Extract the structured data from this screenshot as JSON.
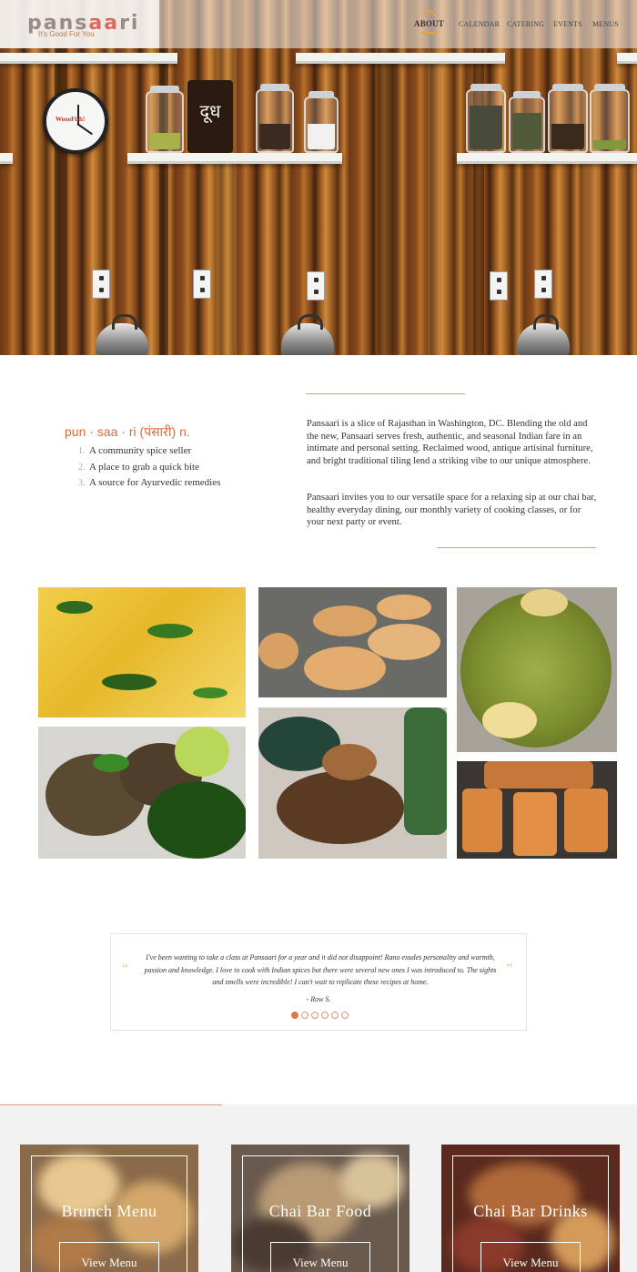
{
  "brand": {
    "name_part1": "pans",
    "name_accent": "aa",
    "name_part2": "ri",
    "tagline": "It's Good For You"
  },
  "nav": {
    "items": [
      {
        "label": "ABOUT",
        "active": true
      },
      {
        "label": "CALENDAR",
        "active": false
      },
      {
        "label": "CATERING",
        "active": false
      },
      {
        "label": "EVENTS",
        "active": false
      },
      {
        "label": "MENUS",
        "active": false
      }
    ]
  },
  "hero": {
    "mug_text": "दूध",
    "clock_text": "WoooFish!"
  },
  "about": {
    "pronunciation": "pun · saa · ri (पंसारी) n.",
    "definitions": [
      {
        "num": "1.",
        "text": "A community spice seller"
      },
      {
        "num": "2.",
        "text": "A place to grab a quick bite"
      },
      {
        "num": "3.",
        "text": "A source for Ayurvedic remedies"
      }
    ],
    "paragraph1": "Pansaari is a slice of Rajasthan in Washington, DC. Blending the old and the new, Pansaari serves fresh, authentic, and seasonal Indian fare in an intimate and personal setting. Reclaimed wood, antique artisinal furniture, and bright traditional tiling lend a striking vibe to our unique atmosphere.",
    "paragraph2": "Pansaari invites you to our versatile space for a relaxing sip at our chai bar, healthy everyday dining, our monthly variety of cooking classes, or for your next party or event."
  },
  "testimonial": {
    "open_quote": "“",
    "close_quote": "”",
    "quote": "I've been wanting to take a class at Pansaari for a year and it did not disappoint! Rano exudes personality and warmth, passion and knowledge. I love to cook with Indian spices but there were several new ones I was introduced to. The sights and smells were incredible! I can't wait to replicate these recipes at home.",
    "author": "- Row S.",
    "slide_count": 6,
    "active_slide": 1
  },
  "menus": [
    {
      "title": "Brunch Menu",
      "button": "View Menu"
    },
    {
      "title": "Chai Bar Food",
      "button": "View Menu"
    },
    {
      "title": "Chai Bar Drinks",
      "button": "View Menu"
    }
  ],
  "colors": {
    "accent_orange": "#d96a3e",
    "nav_underline": "#e8a23a",
    "dot_active": "#e0744a"
  }
}
